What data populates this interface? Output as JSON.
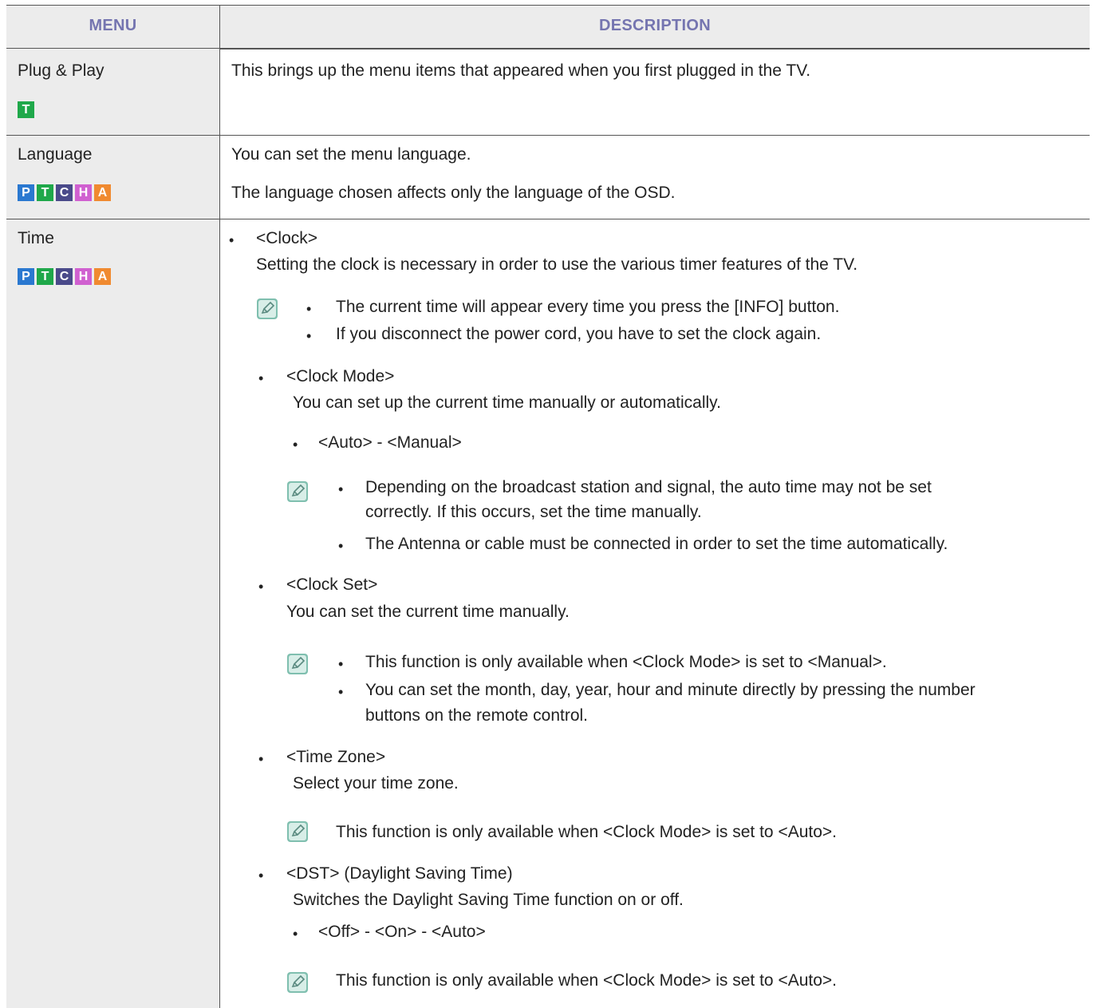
{
  "table": {
    "headers": {
      "menu": "MENU",
      "description": "DESCRIPTION"
    },
    "rows": [
      {
        "menu": "Plug & Play",
        "badges": [
          "T"
        ],
        "description": "This brings up the menu items that appeared when you first plugged in the TV."
      },
      {
        "menu": "Language",
        "badges": [
          "P",
          "T",
          "C",
          "H",
          "A"
        ],
        "description": [
          "You can set the menu language.",
          "The language chosen affects only the language of the OSD."
        ]
      },
      {
        "menu": "Time",
        "badges": [
          "P",
          "T",
          "C",
          "H",
          "A"
        ],
        "clock": {
          "title": "<Clock>",
          "desc": "Setting the clock is necessary in order to use the various timer features of the TV.",
          "notes": [
            "The current time will appear every time you press the [INFO] button.",
            "If you disconnect the power cord, you have to set the clock again."
          ]
        },
        "clock_mode": {
          "title": "<Clock Mode>",
          "desc": "You can set up the current time manually or automatically.",
          "options": "<Auto> - <Manual>",
          "notes": [
            "Depending on the broadcast station and signal, the auto time may not be set",
            "correctly. If this occurs, set the time manually.",
            "The Antenna or cable must be connected in order to set the time automatically."
          ]
        },
        "clock_set": {
          "title": "<Clock Set>",
          "desc": "You can set the current time manually.",
          "notes": [
            "This function is only available when <Clock Mode> is set to <Manual>.",
            "You can set the month, day, year, hour and minute directly by pressing the number",
            "buttons on the remote control."
          ]
        },
        "time_zone": {
          "title": "<Time Zone>",
          "desc": "Select your time zone.",
          "note": "This function is only available when <Clock Mode> is set to <Auto>."
        },
        "dst": {
          "title": "<DST> (Daylight Saving Time)",
          "desc": "Switches the Daylight Saving Time function on or off.",
          "options": "<Off> - <On> - <Auto>",
          "note": "This function is only available when <Clock Mode> is set to <Auto>."
        }
      }
    ]
  },
  "badge_colors": {
    "P": "#2a78d0",
    "T": "#1fa84a",
    "C": "#4a4a8a",
    "H": "#d060d0",
    "A": "#f08a30"
  },
  "icons": {
    "note": "note-pencil-icon"
  },
  "colors": {
    "header_text": "#7575b0",
    "menu_column_bg": "#ececec",
    "header_bg": "#ececec",
    "border": "#555555"
  }
}
